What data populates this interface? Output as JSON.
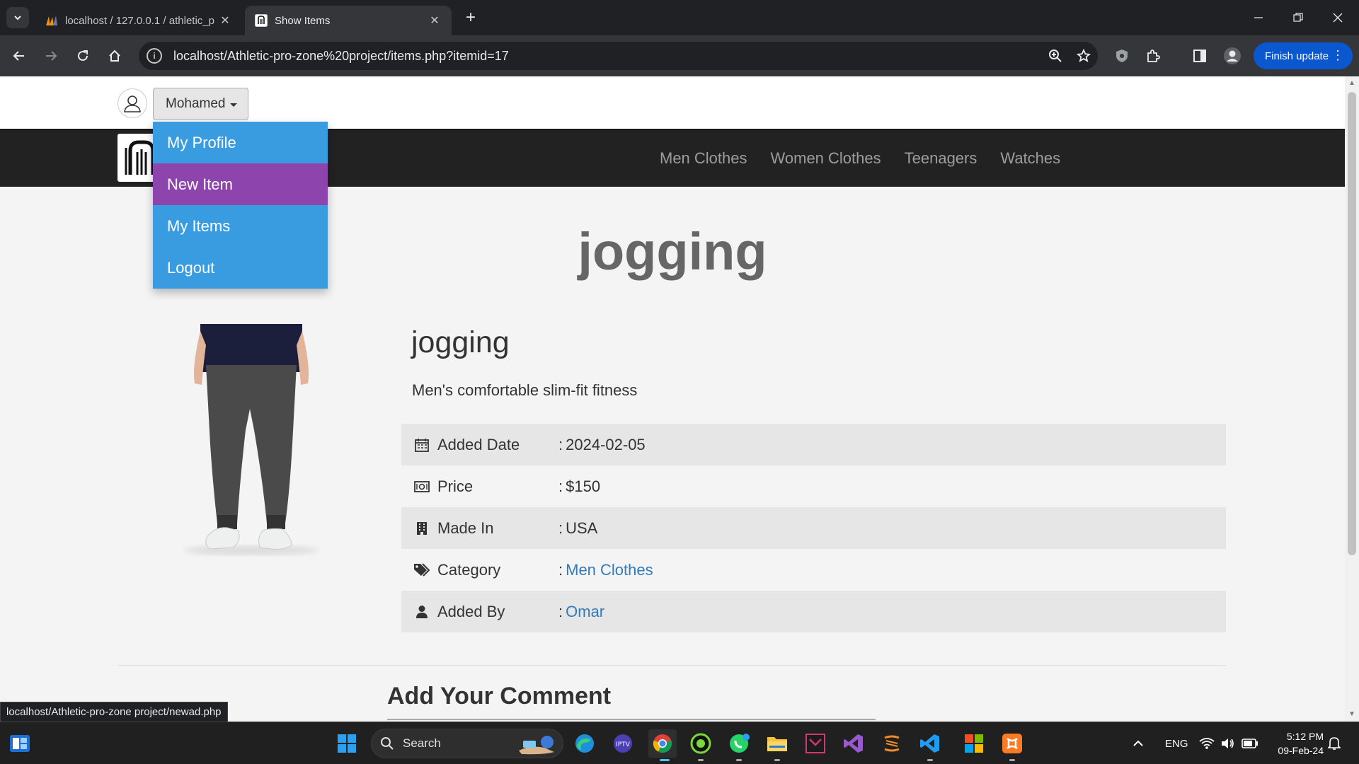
{
  "browser": {
    "tabs": [
      {
        "title": "localhost / 127.0.0.1 / athletic_p",
        "active": false
      },
      {
        "title": "Show Items",
        "active": true
      }
    ],
    "url": "localhost/Athletic-pro-zone%20project/items.php?itemid=17",
    "finish_update_label": "Finish update",
    "status_url": "localhost/Athletic-pro-zone project/newad.php"
  },
  "header": {
    "username": "Mohamed",
    "dropdown": [
      "My Profile",
      "New Item",
      "My Items",
      "Logout"
    ],
    "dropdown_active": "New Item"
  },
  "nav": {
    "links": [
      "Men Clothes",
      "Women Clothes",
      "Teenagers",
      "Watches"
    ]
  },
  "item": {
    "page_title": "jogging",
    "name": "jogging",
    "description": "Men's comfortable slim-fit fitness",
    "properties": [
      {
        "icon": "calendar-icon",
        "label": "Added Date",
        "value": "2024-02-05",
        "link": false
      },
      {
        "icon": "money-icon",
        "label": "Price",
        "value": "$150",
        "link": false
      },
      {
        "icon": "building-icon",
        "label": "Made In",
        "value": "USA",
        "link": false
      },
      {
        "icon": "tags-icon",
        "label": "Category",
        "value": "Men Clothes",
        "link": true
      },
      {
        "icon": "user-icon",
        "label": "Added By",
        "value": "Omar",
        "link": true
      }
    ]
  },
  "comments": {
    "heading": "Add Your Comment"
  },
  "taskbar": {
    "search_label": "Search",
    "language": "ENG",
    "time": "5:12 PM",
    "date": "09-Feb-24"
  },
  "colors": {
    "dropdown_bg": "#3a9ce0",
    "dropdown_active_bg": "#8e44ad",
    "navbar_bg": "#222222",
    "link": "#337ab7"
  }
}
